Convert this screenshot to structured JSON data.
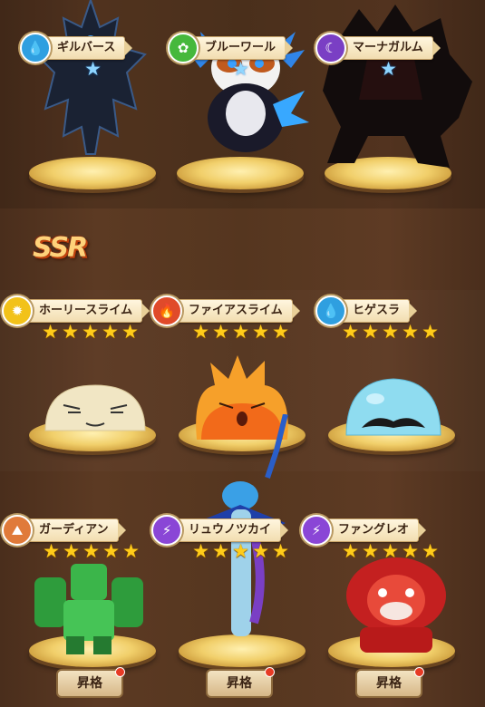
{
  "rows": [
    {
      "units": [
        {
          "name": "ギルバース",
          "element": "water",
          "stars": 1,
          "star_style": "blue"
        },
        {
          "name": "ブルーワール",
          "element": "wind",
          "stars": 1,
          "star_style": "blue"
        },
        {
          "name": "マーナガルム",
          "element": "dark",
          "stars": 1,
          "star_style": "blue"
        }
      ]
    },
    {
      "units": [
        {
          "name": "ホーリースライム",
          "element": "light",
          "stars": 5,
          "star_style": "gold"
        },
        {
          "name": "ファイアスライム",
          "element": "fire",
          "stars": 5,
          "star_style": "gold"
        },
        {
          "name": "ヒゲスラ",
          "element": "water",
          "stars": 5,
          "star_style": "gold"
        }
      ]
    },
    {
      "units": [
        {
          "name": "ガーディアン",
          "element": "earth",
          "stars": 5,
          "star_style": "gold",
          "action": "昇格",
          "notification": true
        },
        {
          "name": "リュウノツカイ",
          "element": "thunder",
          "stars": 5,
          "star_style": "gold",
          "action": "昇格",
          "notification": true
        },
        {
          "name": "ファングレオ",
          "element": "thunder",
          "stars": 5,
          "star_style": "gold",
          "action": "昇格",
          "notification": true
        }
      ]
    }
  ],
  "section_badge": "SSR",
  "element_colors": {
    "water": "#2f9fe0",
    "wind": "#46b83c",
    "dark": "#7a3fc4",
    "light": "#f2c21a",
    "fire": "#e04a2a",
    "earth": "#e07a3a",
    "thunder": "#8a46d6"
  }
}
